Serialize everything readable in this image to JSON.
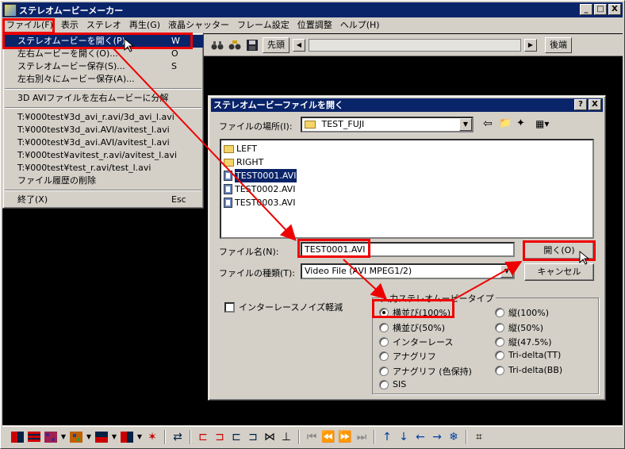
{
  "window": {
    "title": "ステレオムービーメーカー",
    "min": "_",
    "max": "□",
    "close": "X"
  },
  "menubar": [
    "ファイル(F)",
    "表示",
    "ステレオ",
    "再生(G)",
    "液晶シャッター",
    "フレーム設定",
    "位置調整",
    "ヘルプ(H)"
  ],
  "toolbar_top": {
    "head_button": "先頭",
    "tail_button": "後端"
  },
  "file_menu": {
    "items": [
      {
        "label": "ステレオムービーを開く(P)",
        "shortcut": "W"
      },
      {
        "label": "左右ムービーを開く(O)...",
        "shortcut": "O"
      },
      {
        "label": "ステレオムービー保存(S)...",
        "shortcut": "S"
      },
      {
        "label": "左右別々にムービー保存(A)...",
        "shortcut": ""
      }
    ],
    "split_item": "3D AVIファイルを左右ムービーに分解",
    "recent": [
      "T:¥000test¥3d_avi_r.avi/3d_avi_l.avi",
      "T:¥000test¥3d_avi.AVI/avitest_l.avi",
      "T:¥000test¥3d_avi.AVI/avitest_l.avi",
      "T:¥000test¥avitest_r.avi/avitest_l.avi",
      "T:¥000test¥test_r.avi/test_l.avi"
    ],
    "clear_history": "ファイル履歴の削除",
    "exit": {
      "label": "終了(X)",
      "shortcut": "Esc"
    }
  },
  "dialog": {
    "title": "ステレオムービーファイルを開く",
    "help_btn": "?",
    "close_btn": "X",
    "location_label": "ファイルの場所(I):",
    "location_value": "TEST_FUJI",
    "files": [
      {
        "name": "LEFT",
        "type": "folder"
      },
      {
        "name": "RIGHT",
        "type": "folder"
      },
      {
        "name": "TEST0001.AVI",
        "type": "avi",
        "selected": true
      },
      {
        "name": "TEST0002.AVI",
        "type": "avi"
      },
      {
        "name": "TEST0003.AVI",
        "type": "avi"
      }
    ],
    "filename_label": "ファイル名(N):",
    "filename_value": "TEST0001.AVI",
    "filetype_label": "ファイルの種類(T):",
    "filetype_value": "Video File (AVI MPEG1/2)",
    "open_button": "開く(O)",
    "cancel_button": "キャンセル",
    "interlace_checkbox": "インターレースノイズ軽減",
    "group_title": "入力ステレオムービータイプ",
    "radios_left": [
      "横並び(100%)",
      "横並び(50%)",
      "インターレース",
      "アナグリフ",
      "アナグリフ (色保持)",
      "SIS"
    ],
    "radios_right": [
      "縦(100%)",
      "縦(50%)",
      "縦(47.5%)",
      "Tri-delta(TT)",
      "Tri-delta(BB)"
    ]
  },
  "colors": {
    "title_bar": "#0a246a",
    "highlight_box": "#e00000",
    "face": "#d4d0c8"
  }
}
